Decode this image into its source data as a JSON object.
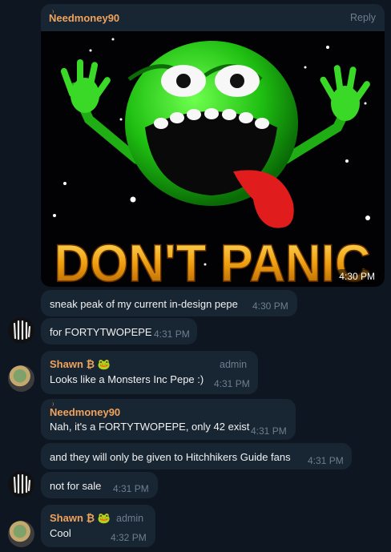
{
  "messages": [
    {
      "sender": "Needmoney90",
      "reply": "Reply",
      "image_caption": "DON'T PANIC",
      "time": "4:30 PM"
    },
    {
      "text": "sneak peak of my current in-design pepe",
      "time": "4:30 PM"
    },
    {
      "text": "for FORTYTWOPEPE",
      "time": "4:31 PM"
    },
    {
      "sender": "Shawn ₿ 🐸",
      "role": "admin",
      "text": "Looks like a Monsters Inc Pepe :)",
      "time": "4:31 PM"
    },
    {
      "sender": "Needmoney90",
      "text": "Nah, it's a FORTYTWOPEPE, only 42 exist",
      "time": "4:31 PM"
    },
    {
      "text": "and they will only be given to Hitchhikers Guide fans",
      "time": "4:31 PM"
    },
    {
      "text": "not for sale",
      "time": "4:31 PM"
    },
    {
      "sender": "Shawn ₿ 🐸",
      "role": "admin",
      "text": "Cool",
      "time": "4:32 PM"
    }
  ],
  "colors": {
    "background": "#0e1621",
    "bubble": "#182533",
    "sender": "#f0a35c",
    "timestamp": "#6d7f8f"
  }
}
